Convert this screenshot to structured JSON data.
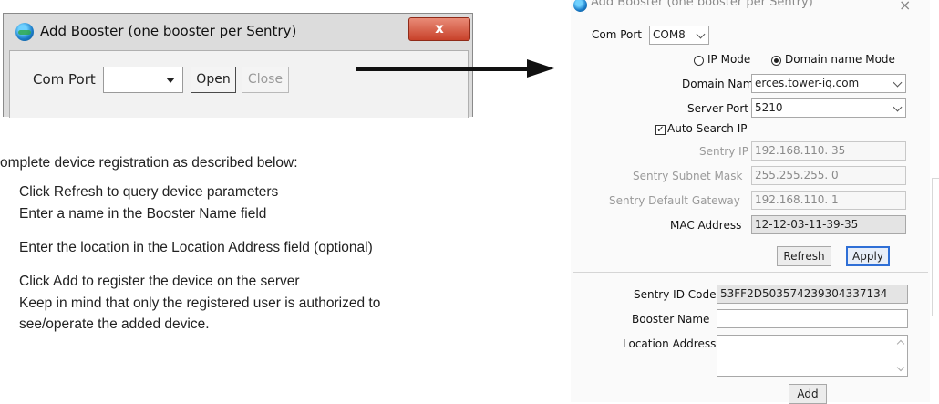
{
  "small_dialog": {
    "title": "Add Booster (one booster per Sentry)",
    "close_label": "x",
    "com_port_label": "Com Port",
    "com_port_value": "",
    "open_label": "Open",
    "close_button_label": "Close"
  },
  "instructions": {
    "intro": "omplete device registration as described below:",
    "steps": [
      "Click Refresh to query device parameters",
      "Enter a name in the Booster Name field",
      "Enter the location in the Location Address field (optional)",
      "Click Add to register the device on the server",
      "Keep in mind that only the registered user is authorized to"
    ],
    "continuation": "see/operate the added device."
  },
  "big_dialog": {
    "title": "Add Booster (one booster per Sentry)",
    "close_label": "×",
    "com_port_label": "Com Port",
    "com_port_value": "COM8",
    "ip_mode_label": "IP Mode",
    "domain_mode_label": "Domain name Mode",
    "domain_name_label": "Domain Name",
    "domain_name_value": "erces.tower-iq.com",
    "server_port_label": "Server Port",
    "server_port_value": "5210",
    "auto_search_label": "Auto Search IP",
    "sentry_ip_label": "Sentry IP",
    "sentry_ip_value": "192.168.110. 35",
    "subnet_label": "Sentry Subnet Mask",
    "subnet_value": "255.255.255. 0",
    "gateway_label": "Sentry Default Gateway",
    "gateway_value": "192.168.110. 1",
    "mac_label": "MAC Address",
    "mac_value": "12-12-03-11-39-35",
    "refresh_label": "Refresh",
    "apply_label": "Apply",
    "sentry_id_label": "Sentry ID Code",
    "sentry_id_value": "53FF2D503574239304337134",
    "booster_name_label": "Booster Name",
    "booster_name_value": "",
    "location_label": "Location Address",
    "location_value": "",
    "add_label": "Add"
  }
}
